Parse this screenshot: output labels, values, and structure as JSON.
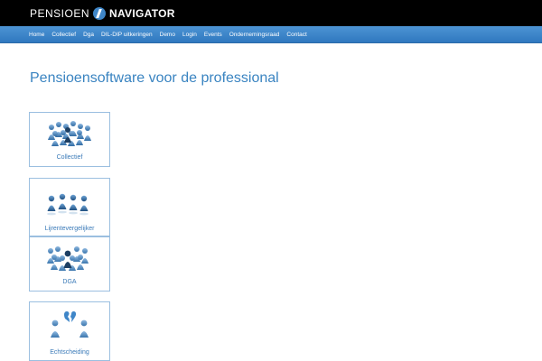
{
  "header": {
    "brand_word1": "PENSIOEN",
    "brand_word2": "NAVIGATOR",
    "logo_icon": "navigator-logo-icon"
  },
  "nav": {
    "items": [
      "Home",
      "Collectief",
      "Dga",
      "DIL-DIP uitkeringen",
      "Demo",
      "Login",
      "Events",
      "Ondernemingsraad",
      "Contact"
    ]
  },
  "main": {
    "title": "Pensioensoftware voor de professional",
    "tiles": [
      {
        "label": "Collectief",
        "icon": "crowd-figures-icon"
      },
      {
        "label": "Lijrentevergelijker",
        "icon": "row-figures-icon"
      },
      {
        "label": "DGA",
        "icon": "group-figures-icon"
      },
      {
        "label": "Echtscheiding",
        "icon": "separation-figures-icon"
      }
    ]
  },
  "colors": {
    "nav_blue": "#3a84c8",
    "title_blue": "#3a84c1",
    "figure_blue": "#4a86bd",
    "figure_dark": "#1d3f63"
  }
}
